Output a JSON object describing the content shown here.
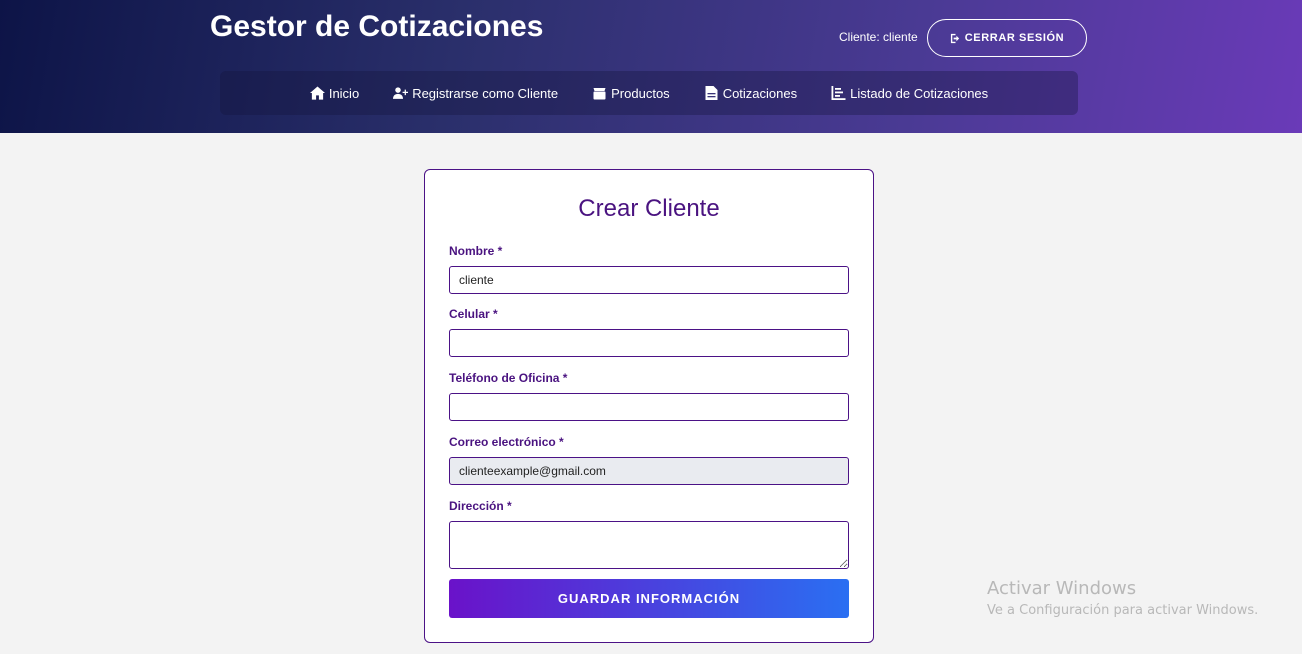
{
  "header": {
    "title": "Gestor de Cotizaciones",
    "user_label": "Cliente: cliente",
    "logout_label": "CERRAR SESIÓN"
  },
  "nav": {
    "items": [
      {
        "label": "Inicio",
        "icon": "home-icon"
      },
      {
        "label": "Registrarse como Cliente",
        "icon": "user-plus-icon"
      },
      {
        "label": "Productos",
        "icon": "box-icon"
      },
      {
        "label": "Cotizaciones",
        "icon": "file-invoice-icon"
      },
      {
        "label": "Listado de Cotizaciones",
        "icon": "chart-list-icon"
      }
    ]
  },
  "form": {
    "title": "Crear Cliente",
    "fields": {
      "nombre": {
        "label": "Nombre *",
        "value": "cliente"
      },
      "celular": {
        "label": "Celular *",
        "value": ""
      },
      "telefono": {
        "label": "Teléfono de Oficina *",
        "value": ""
      },
      "correo": {
        "label": "Correo electrónico *",
        "value": "clienteexample@gmail.com"
      },
      "direccion": {
        "label": "Dirección *",
        "value": ""
      }
    },
    "submit_label": "GUARDAR INFORMACIÓN"
  },
  "watermark": {
    "title": "Activar Windows",
    "subtitle": "Ve a Configuración para activar Windows."
  },
  "colors": {
    "accent": "#4a1380",
    "button_start": "#6a12c9",
    "button_end": "#2a6ff2"
  }
}
